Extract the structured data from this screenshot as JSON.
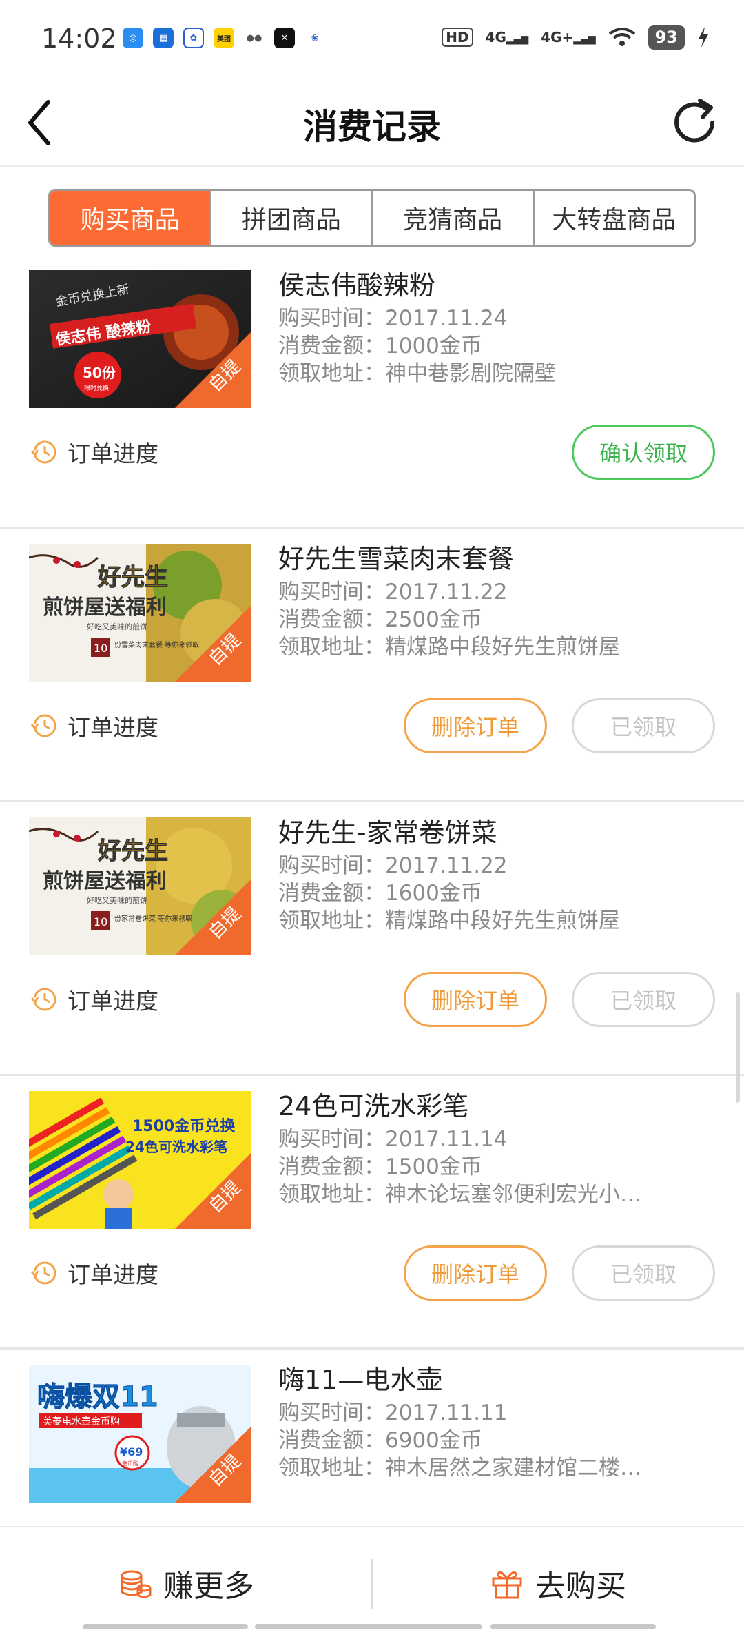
{
  "status_bar": {
    "time": "14:02",
    "app_icons": [
      "network-icon",
      "news-icon",
      "baidu-icon",
      "meituan-icon",
      "wechat-icon",
      "capcut-icon",
      "paw-icon"
    ],
    "meituan_label": "美团",
    "signal_1": "4G",
    "signal_2": "4G+",
    "hd_label": "HD",
    "battery": "93"
  },
  "header": {
    "title": "消费记录",
    "back_icon": "chevron-left-icon",
    "refresh_icon": "refresh-icon"
  },
  "tabs": [
    {
      "label": "购买商品",
      "active": true
    },
    {
      "label": "拼团商品",
      "active": false
    },
    {
      "label": "竞猜商品",
      "active": false
    },
    {
      "label": "大转盘商品",
      "active": false
    }
  ],
  "labels": {
    "buy_time": "购买时间：",
    "amount": "消费金额：",
    "address": "领取地址：",
    "order_progress": "订单进度",
    "pickup_tag": "自提"
  },
  "orders": [
    {
      "title": "侯志伟酸辣粉",
      "buy_time": "2017.11.24",
      "amount": "1000金币",
      "address": "神中巷影剧院隔壁",
      "actions": [
        {
          "label": "确认领取",
          "style": "confirm"
        }
      ],
      "thumb": {
        "line1": "金币兑换上新",
        "line2": "侯志伟 酸辣粉",
        "badge": "50份",
        "badge_sub": "限时兑换"
      }
    },
    {
      "title": "好先生雪菜肉末套餐",
      "buy_time": "2017.11.22",
      "amount": "2500金币",
      "address": "精煤路中段好先生煎饼屋",
      "actions": [
        {
          "label": "删除订单",
          "style": "delete"
        },
        {
          "label": "已领取",
          "style": "done"
        }
      ],
      "thumb": {
        "line1": "好先生",
        "line2": "煎饼屋送福利",
        "sub": "好吃又美味的煎饼",
        "badge": "10",
        "badge_sub": "份雪菜肉末套餐 等你来领取"
      }
    },
    {
      "title": "好先生-家常卷饼菜",
      "buy_time": "2017.11.22",
      "amount": "1600金币",
      "address": "精煤路中段好先生煎饼屋",
      "actions": [
        {
          "label": "删除订单",
          "style": "delete"
        },
        {
          "label": "已领取",
          "style": "done"
        }
      ],
      "thumb": {
        "line1": "好先生",
        "line2": "煎饼屋送福利",
        "sub": "好吃又美味的煎饼",
        "badge": "10",
        "badge_sub": "份家常卷饼菜 等你来领取"
      }
    },
    {
      "title": "24色可洗水彩笔",
      "buy_time": "2017.11.14",
      "amount": "1500金币",
      "address": "神木论坛塞邻便利宏光小…",
      "actions": [
        {
          "label": "删除订单",
          "style": "delete"
        },
        {
          "label": "已领取",
          "style": "done"
        }
      ],
      "thumb": {
        "line1": "1500金币兑换",
        "line2": "24色可洗水彩笔"
      }
    },
    {
      "title": "嗨11—电水壶",
      "buy_time": "2017.11.11",
      "amount": "6900金币",
      "address": "神木居然之家建材馆二楼…",
      "actions": [],
      "thumb": {
        "line1": "嗨爆双11",
        "line2": "美菱电水壶金币购",
        "badge": "¥69",
        "badge_sub": "金币购"
      }
    }
  ],
  "bottom_bar": {
    "earn_more": "赚更多",
    "go_buy": "去购买",
    "earn_icon": "coins-icon",
    "buy_icon": "gift-icon"
  },
  "colors": {
    "accent_orange": "#fd6b35",
    "confirm_green": "#3db54e",
    "delete_orange": "#f09b37",
    "muted_gray": "#c4c4c4"
  }
}
